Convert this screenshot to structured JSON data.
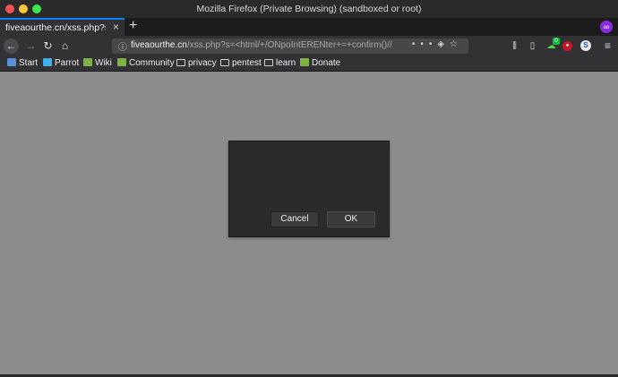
{
  "window": {
    "title": "Mozilla Firefox (Private Browsing) (sandboxed or root)"
  },
  "tab": {
    "title": "fiveaourthe.cn/xss.php?s=%",
    "close_glyph": "×"
  },
  "toolbar": {
    "new_tab_glyph": "+",
    "url_host": "fiveaourthe.cn",
    "url_rest": "/xss.php?s=<html/+/ONpoIntERENter+=+confirm()//",
    "page_actions_glyph": "•••",
    "ext1_badge": "0"
  },
  "bookmarks": [
    {
      "label": "Start",
      "icon": "start-icon"
    },
    {
      "label": "Parrot",
      "icon": "parrot-icon"
    },
    {
      "label": "Wiki",
      "icon": "leaf-icon"
    },
    {
      "label": "Community",
      "icon": "leaf-icon"
    },
    {
      "label": "privacy",
      "icon": "folder-icon"
    },
    {
      "label": "pentest",
      "icon": "folder-icon"
    },
    {
      "label": "learn",
      "icon": "folder-icon"
    },
    {
      "label": "Donate",
      "icon": "leaf-icon"
    }
  ],
  "dialog": {
    "message": "",
    "cancel_label": "Cancel",
    "ok_label": "OK"
  },
  "colors": {
    "accent": "#0a84ff",
    "content_bg": "#8c8c8c",
    "dialog_bg": "#2b2b2b"
  }
}
